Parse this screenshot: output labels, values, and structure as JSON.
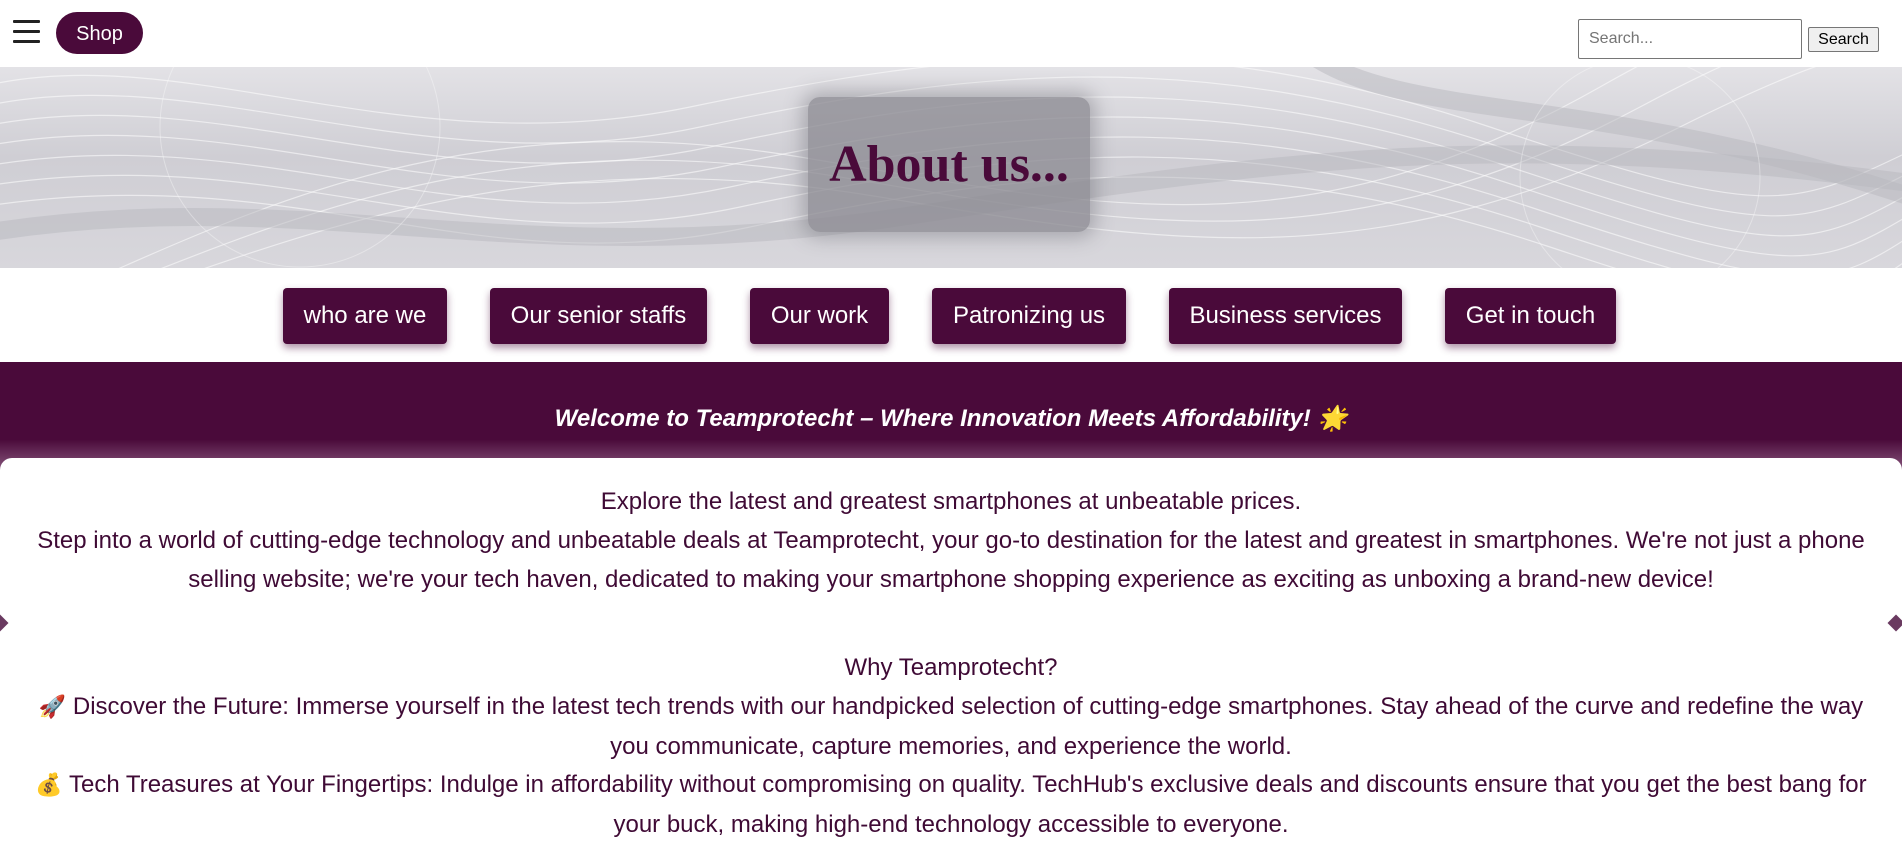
{
  "header": {
    "shop_label": "Shop",
    "search_placeholder": "Search...",
    "search_button_label": "Search"
  },
  "hero": {
    "title": "About us..."
  },
  "section_nav": {
    "items": [
      {
        "label": "who are we"
      },
      {
        "label": "Our senior staffs"
      },
      {
        "label": "Our work"
      },
      {
        "label": "Patronizing us"
      },
      {
        "label": "Business services"
      },
      {
        "label": "Get in touch"
      }
    ]
  },
  "welcome": {
    "text": "Welcome to Teamprotecht – Where Innovation Meets Affordability! 🌟"
  },
  "intro": {
    "lead": "Explore the latest and greatest smartphones at unbeatable prices.",
    "body": "Step into a world of cutting-edge technology and unbeatable deals at Teamprotecht, your go-to destination for the latest and greatest in smartphones. We're not just a phone selling website; we're your tech haven, dedicated to making your smartphone shopping experience as exciting as unboxing a brand-new device!"
  },
  "why": {
    "heading": "Why Teamprotecht?",
    "points": [
      {
        "icon": "🚀",
        "text": "Discover the Future: Immerse yourself in the latest tech trends with our handpicked selection of cutting-edge smartphones. Stay ahead of the curve and redefine the way you communicate, capture memories, and experience the world."
      },
      {
        "icon": "💰",
        "text": "Tech Treasures at Your Fingertips: Indulge in affordability without compromising on quality. TechHub's exclusive deals and discounts ensure that you get the best bang for your buck, making high-end technology accessible to everyone."
      }
    ]
  },
  "colors": {
    "brand": "#4a0a3a",
    "text": "#3f0a35",
    "hero_bg": "#d6d5da"
  }
}
